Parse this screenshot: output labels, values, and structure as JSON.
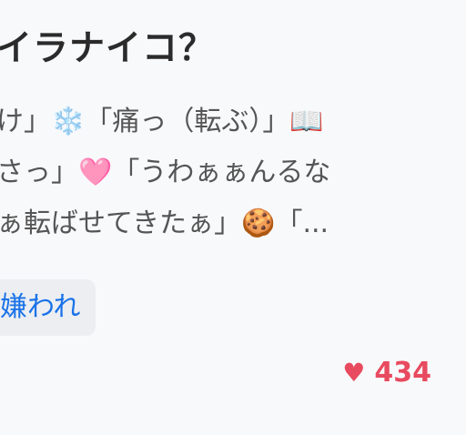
{
  "post": {
    "title": "イラナイコ？",
    "excerpt_lines": [
      [
        "け」",
        "❄️",
        "「痛っ（転ぶ）」",
        "📖"
      ],
      [
        "さっ」",
        "🩷",
        "「うわぁぁんるな"
      ],
      [
        "ぁ転ばせてきたぁ」",
        "🍪",
        "「..."
      ]
    ],
    "tag": "嫌われ",
    "likes": "434",
    "like_icon": "heart-icon"
  }
}
